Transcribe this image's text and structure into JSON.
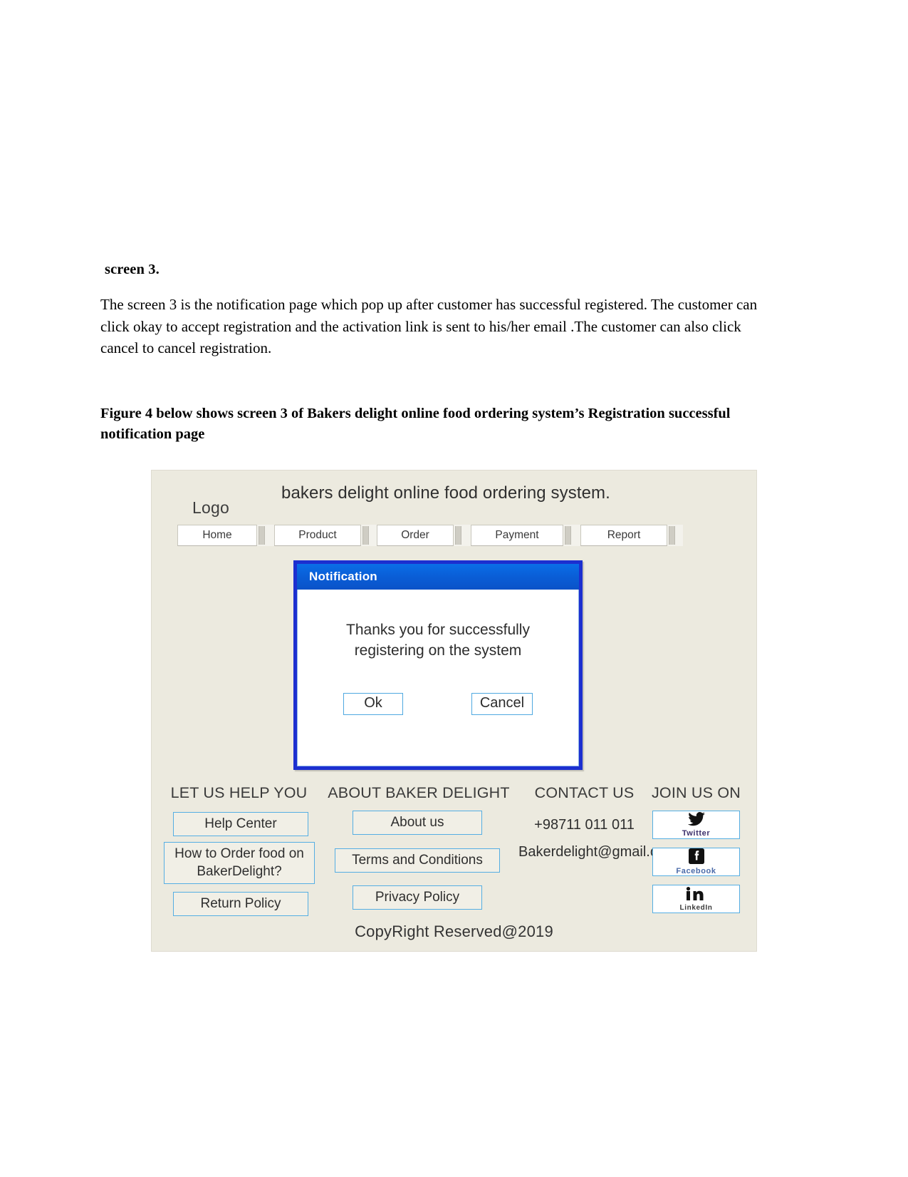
{
  "document": {
    "section_heading": "screen 3.",
    "paragraph": "The screen 3 is the notification page which pop up after customer has successful registered. The customer can click okay to accept registration and the activation link is sent to his/her email .The customer can also click cancel to cancel registration.",
    "figure_caption": "Figure 4 below shows screen 3 of Bakers delight online food ordering system’s Registration successful notification page"
  },
  "mockup": {
    "logo_label": "Logo",
    "site_title": "bakers delight online food ordering system.",
    "nav": [
      {
        "label": "Home"
      },
      {
        "label": "Product"
      },
      {
        "label": "Order"
      },
      {
        "label": "Payment"
      },
      {
        "label": "Report"
      }
    ],
    "dialog": {
      "title": "Notification",
      "message": "Thanks you for successfully registering on the system",
      "ok_label": "Ok",
      "cancel_label": "Cancel",
      "border_color": "#1c2fd0",
      "titlebar_color": "#0a5fd8"
    },
    "footer": {
      "help": {
        "heading": "LET US HELP YOU",
        "items": [
          "Help Center",
          "How to Order food on BakerDelight?",
          "Return Policy"
        ]
      },
      "about": {
        "heading": "ABOUT BAKER DELIGHT",
        "items": [
          "About us",
          "Terms and Conditions",
          "Privacy Policy"
        ]
      },
      "contact": {
        "heading": "CONTACT US",
        "phone": "+98711 011 011",
        "email": "Bakerdelight@gmail.com"
      },
      "social": {
        "heading": "JOIN US ON",
        "items": [
          {
            "label": "Twitter",
            "icon": "twitter-icon"
          },
          {
            "label": "Facebook",
            "icon": "facebook-icon"
          },
          {
            "label": "LinkedIn",
            "icon": "linkedin-icon"
          }
        ]
      },
      "copyright": "CopyRight Reserved@2019"
    },
    "accent_color": "#55aee3",
    "background_color": "#eceadf"
  }
}
